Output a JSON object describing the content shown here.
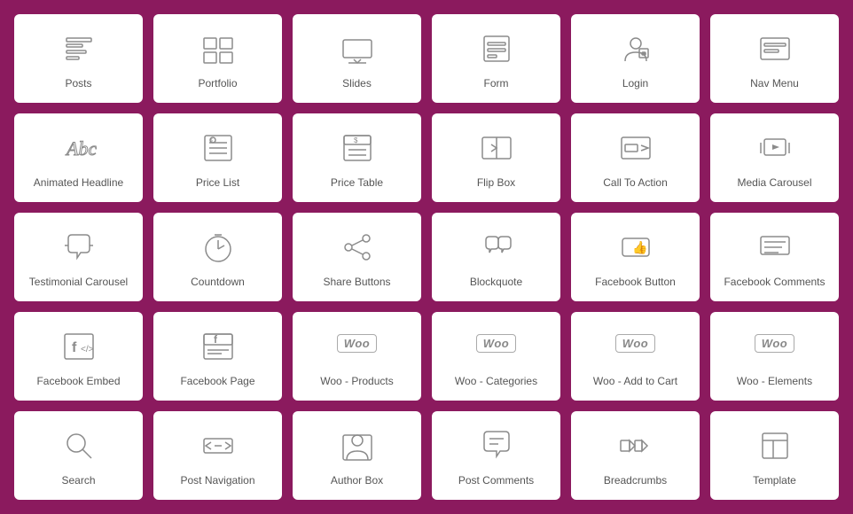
{
  "cards": [
    {
      "id": "posts",
      "label": "Posts",
      "icon": "posts"
    },
    {
      "id": "portfolio",
      "label": "Portfolio",
      "icon": "portfolio"
    },
    {
      "id": "slides",
      "label": "Slides",
      "icon": "slides"
    },
    {
      "id": "form",
      "label": "Form",
      "icon": "form"
    },
    {
      "id": "login",
      "label": "Login",
      "icon": "login"
    },
    {
      "id": "nav-menu",
      "label": "Nav Menu",
      "icon": "navmenu"
    },
    {
      "id": "animated-headline",
      "label": "Animated Headline",
      "icon": "animated-headline"
    },
    {
      "id": "price-list",
      "label": "Price List",
      "icon": "price-list"
    },
    {
      "id": "price-table",
      "label": "Price Table",
      "icon": "price-table"
    },
    {
      "id": "flip-box",
      "label": "Flip Box",
      "icon": "flip-box"
    },
    {
      "id": "call-to-action",
      "label": "Call To Action",
      "icon": "call-to-action"
    },
    {
      "id": "media-carousel",
      "label": "Media Carousel",
      "icon": "media-carousel"
    },
    {
      "id": "testimonial-carousel",
      "label": "Testimonial Carousel",
      "icon": "testimonial-carousel"
    },
    {
      "id": "countdown",
      "label": "Countdown",
      "icon": "countdown"
    },
    {
      "id": "share-buttons",
      "label": "Share Buttons",
      "icon": "share-buttons"
    },
    {
      "id": "blockquote",
      "label": "Blockquote",
      "icon": "blockquote"
    },
    {
      "id": "facebook-button",
      "label": "Facebook Button",
      "icon": "facebook-button"
    },
    {
      "id": "facebook-comments",
      "label": "Facebook Comments",
      "icon": "facebook-comments"
    },
    {
      "id": "facebook-embed",
      "label": "Facebook Embed",
      "icon": "facebook-embed"
    },
    {
      "id": "facebook-page",
      "label": "Facebook Page",
      "icon": "facebook-page"
    },
    {
      "id": "woo-products",
      "label": "Woo - Products",
      "icon": "woo"
    },
    {
      "id": "woo-categories",
      "label": "Woo - Categories",
      "icon": "woo"
    },
    {
      "id": "woo-add-to-cart",
      "label": "Woo - Add to Cart",
      "icon": "woo"
    },
    {
      "id": "woo-elements",
      "label": "Woo - Elements",
      "icon": "woo"
    },
    {
      "id": "search",
      "label": "Search",
      "icon": "search"
    },
    {
      "id": "post-navigation",
      "label": "Post Navigation",
      "icon": "post-navigation"
    },
    {
      "id": "author-box",
      "label": "Author Box",
      "icon": "author-box"
    },
    {
      "id": "post-comments",
      "label": "Post Comments",
      "icon": "post-comments"
    },
    {
      "id": "breadcrumbs",
      "label": "Breadcrumbs",
      "icon": "breadcrumbs"
    },
    {
      "id": "template",
      "label": "Template",
      "icon": "template"
    }
  ]
}
